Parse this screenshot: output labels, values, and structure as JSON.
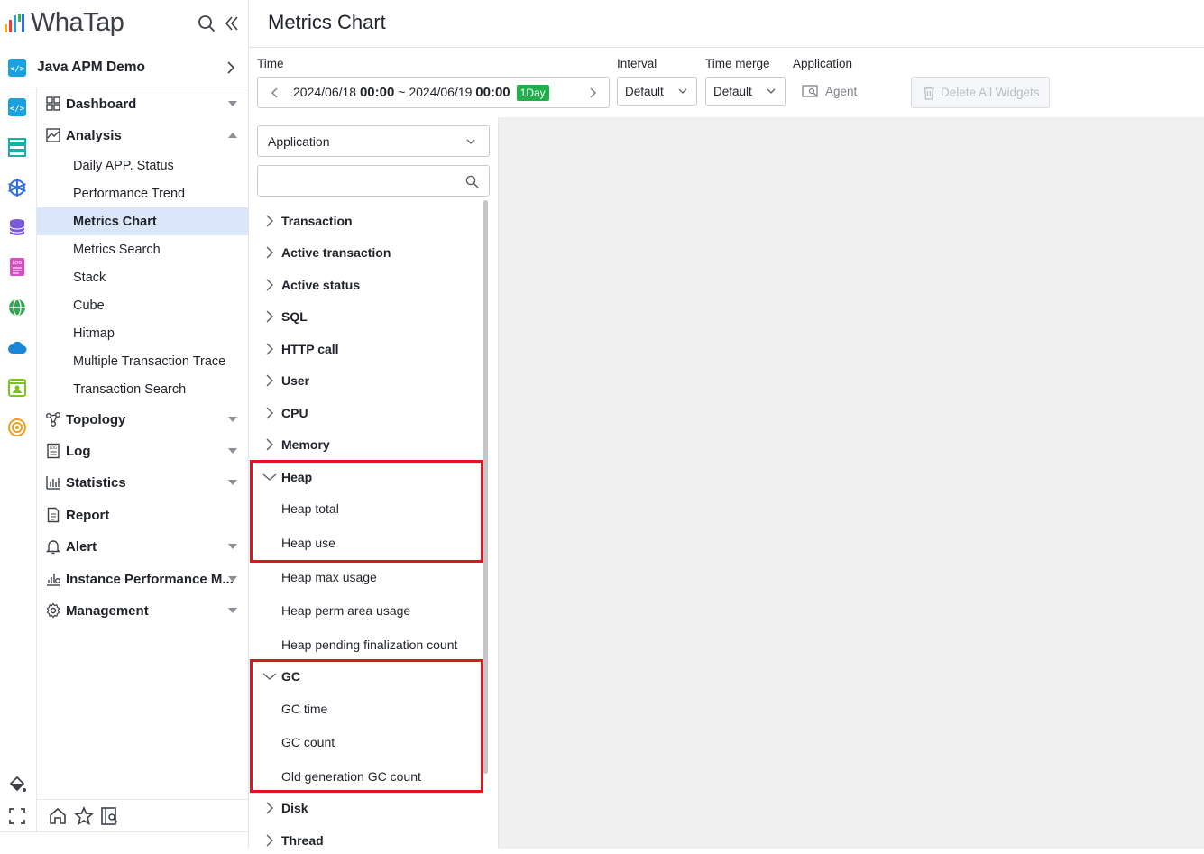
{
  "app": {
    "logo_text": "WhaTap",
    "page_title": "Metrics Chart",
    "project_name": "Java APM Demo"
  },
  "sidebar": {
    "menu": [
      {
        "label": "Dashboard",
        "icon": "dashboard-icon",
        "expandable": true
      },
      {
        "label": "Analysis",
        "icon": "analysis-icon",
        "expanded": true,
        "children": [
          "Daily APP. Status",
          "Performance Trend",
          "Metrics Chart",
          "Metrics Search",
          "Stack",
          "Cube",
          "Hitmap",
          "Multiple Transaction Trace",
          "Transaction Search"
        ]
      },
      {
        "label": "Topology",
        "icon": "topology-icon",
        "expandable": true
      },
      {
        "label": "Log",
        "icon": "log-icon",
        "expandable": true
      },
      {
        "label": "Statistics",
        "icon": "statistics-icon",
        "expandable": true
      },
      {
        "label": "Report",
        "icon": "report-icon"
      },
      {
        "label": "Alert",
        "icon": "bell-icon",
        "expandable": true
      },
      {
        "label": "Instance Performance M...",
        "icon": "instance-performance-icon",
        "expandable": true
      },
      {
        "label": "Management",
        "icon": "gear-icon",
        "expandable": true
      }
    ],
    "active_item": "Metrics Chart",
    "rail_icons": [
      "java-apm-icon",
      "server-icon",
      "kubernetes-icon",
      "database-icon",
      "log-service-icon",
      "url-monitoring-icon",
      "cloud-icon",
      "browser-icon",
      "network-icon"
    ]
  },
  "filters": {
    "time_label": "Time",
    "time_start_date": "2024/06/18",
    "time_start_hm": "00:00",
    "time_sep": "~",
    "time_end_date": "2024/06/19",
    "time_end_hm": "00:00",
    "time_badge": "1Day",
    "interval_label": "Interval",
    "interval_value": "Default",
    "timemerge_label": "Time merge",
    "timemerge_value": "Default",
    "application_label": "Application",
    "agent_label": "Agent",
    "delete_all_label": "Delete All Widgets"
  },
  "metrics_panel": {
    "category_select": "Application",
    "search_placeholder": "",
    "categories": [
      {
        "label": "Transaction",
        "expanded": false
      },
      {
        "label": "Active transaction",
        "expanded": false
      },
      {
        "label": "Active status",
        "expanded": false
      },
      {
        "label": "SQL",
        "expanded": false
      },
      {
        "label": "HTTP call",
        "expanded": false
      },
      {
        "label": "User",
        "expanded": false
      },
      {
        "label": "CPU",
        "expanded": false
      },
      {
        "label": "Memory",
        "expanded": false
      },
      {
        "label": "Heap",
        "expanded": true,
        "children": [
          "Heap total",
          "Heap use",
          "Heap max usage",
          "Heap perm area usage",
          "Heap pending finalization count"
        ]
      },
      {
        "label": "GC",
        "expanded": true,
        "children": [
          "GC time",
          "GC count",
          "Old generation GC count"
        ]
      },
      {
        "label": "Disk",
        "expanded": false
      },
      {
        "label": "Thread",
        "expanded": false
      }
    ]
  },
  "colors": {
    "highlight_box": "#e3141c",
    "active_menu_bg": "#dbe6fb",
    "badge_green": "#1fb04b"
  }
}
